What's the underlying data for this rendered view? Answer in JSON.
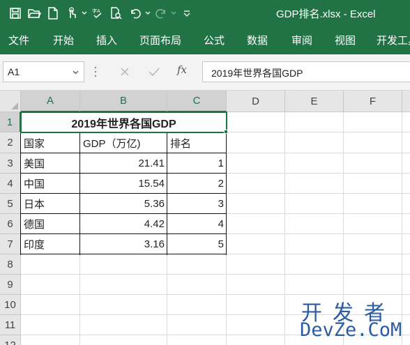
{
  "window": {
    "title": "GDP排名.xlsx  -  Excel"
  },
  "quick_access": [
    "save-icon",
    "open-folder-icon",
    "new-file-icon",
    "touch-mode-icon",
    "spell-check-icon",
    "print-preview-icon",
    "undo-icon",
    "redo-icon",
    "customize-icon"
  ],
  "ribbon_tabs": [
    "文件",
    "开始",
    "插入",
    "页面布局",
    "公式",
    "数据",
    "审阅",
    "视图",
    "开发工具"
  ],
  "formula_bar": {
    "name_box": "A1",
    "fx_label": "fx",
    "content": "2019年世界各国GDP"
  },
  "columns": [
    "A",
    "B",
    "C",
    "D",
    "E",
    "F"
  ],
  "rows": [
    "1",
    "2",
    "3",
    "4",
    "5",
    "6",
    "7",
    "8",
    "9",
    "10",
    "11",
    "12"
  ],
  "sheet": {
    "title": "2019年世界各国GDP",
    "headers": [
      "国家",
      "GDP（万亿)",
      "排名"
    ],
    "data": [
      [
        "美国",
        "21.41",
        "1"
      ],
      [
        "中国",
        "15.54",
        "2"
      ],
      [
        "日本",
        "5.36",
        "3"
      ],
      [
        "德国",
        "4.42",
        "4"
      ],
      [
        "印度",
        "3.16",
        "5"
      ]
    ]
  },
  "watermark": {
    "line1": "开发者",
    "line2": "DevZe.CoM"
  },
  "colors": {
    "accent": "#217346",
    "watermark": "#2b5ba0"
  }
}
